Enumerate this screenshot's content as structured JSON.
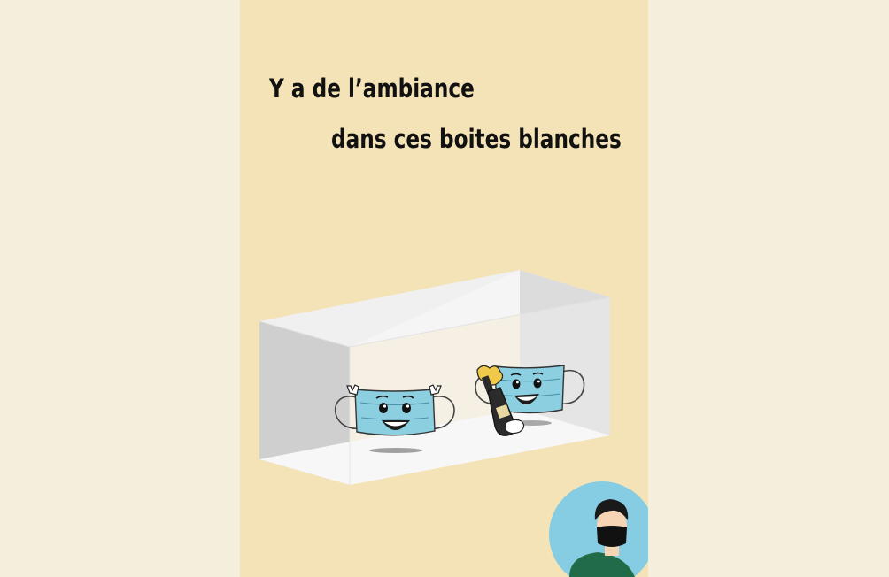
{
  "poster": {
    "title_line1": "Y a de l’ambiance",
    "title_line2": "dans ces boites blanches"
  },
  "colors": {
    "page_background": "#f4efdc",
    "poster_background": "#f4e3b6",
    "mask_blue": "#8ccfe0",
    "avatar_circle": "#86cde3",
    "shirt_green": "#226b48"
  },
  "illustration": {
    "subjects": [
      "mask-left-icon",
      "mask-right-icon",
      "champagne-bottle-icon",
      "avatar-icon"
    ]
  }
}
